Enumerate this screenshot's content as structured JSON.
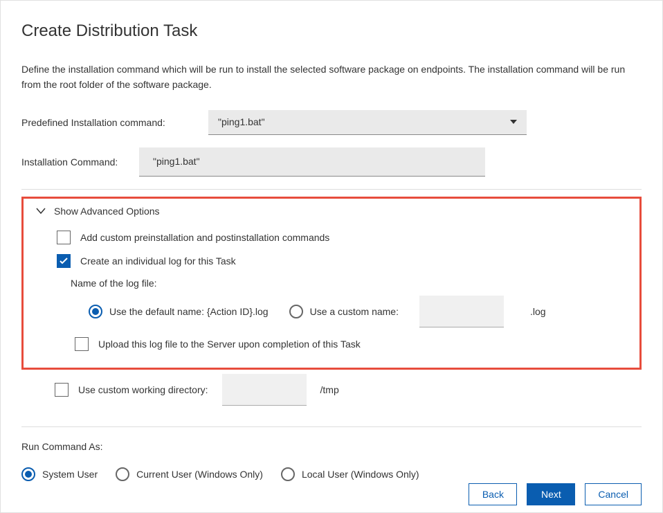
{
  "title": "Create Distribution Task",
  "description": "Define the installation command which will be run to install the selected software package on endpoints. The installation command will be run from the root folder of the software package.",
  "predefined": {
    "label": "Predefined Installation command:",
    "value": "\"ping1.bat\""
  },
  "installCommand": {
    "label": "Installation Command:",
    "value": "\"ping1.bat\""
  },
  "advanced": {
    "toggleLabel": "Show Advanced Options",
    "addPrePost": {
      "label": "Add custom preinstallation and postinstallation commands",
      "checked": false
    },
    "createLog": {
      "label": "Create an individual log for this Task",
      "checked": true
    },
    "logNameLabel": "Name of the log file:",
    "logDefault": {
      "label": "Use the default name: {Action ID}.log",
      "selected": true
    },
    "logCustom": {
      "label": "Use a custom name:",
      "selected": false,
      "value": "",
      "ext": ".log"
    },
    "uploadLog": {
      "label": "Upload this log file to the Server upon completion of this Task",
      "checked": false
    },
    "customWD": {
      "label": "Use custom working directory:",
      "checked": false,
      "value": "",
      "suffix": "/tmp"
    }
  },
  "runAs": {
    "label": "Run Command As:",
    "options": [
      {
        "label": "System User",
        "selected": true
      },
      {
        "label": "Current User (Windows Only)",
        "selected": false
      },
      {
        "label": "Local User (Windows Only)",
        "selected": false
      }
    ]
  },
  "buttons": {
    "back": "Back",
    "next": "Next",
    "cancel": "Cancel"
  }
}
